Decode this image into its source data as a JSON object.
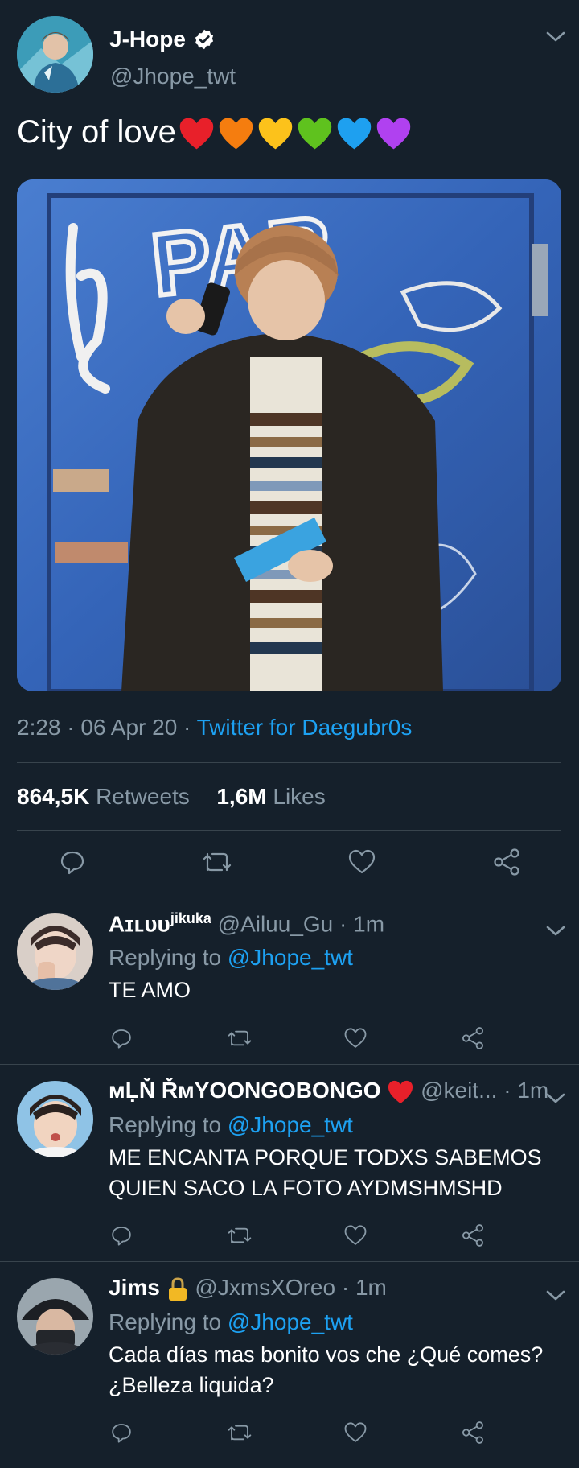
{
  "tweet": {
    "author_name": "J-Hope",
    "handle": "@Jhope_twt",
    "text": "City of love",
    "emoji": [
      "red-heart",
      "orange-heart",
      "yellow-heart",
      "green-heart",
      "blue-heart",
      "purple-heart"
    ],
    "heart_colors": [
      "#e8202a",
      "#f57d0f",
      "#fcc21b",
      "#5fc21e",
      "#1ea0f0",
      "#b041f0"
    ],
    "photo": "person in dark coat in front of graffitied blue door holding blue envelope",
    "time": "2:28",
    "date": "06 Apr 20",
    "source": "Twitter for Daegubr0s",
    "retweets_count": "864,5K",
    "retweets_label": "Retweets",
    "likes_count": "1,6M",
    "likes_label": "Likes",
    "photo_graffiti": "PAR"
  },
  "actions": [
    "reply-icon",
    "retweet-icon",
    "like-icon",
    "share-icon"
  ],
  "replies": [
    {
      "name": "Aɪʟᴜᴜ",
      "name_sup": "jikuka",
      "handle": "@Ailuu_Gu",
      "time": "1m",
      "replying_prefix": "Replying to",
      "mention": "@Jhope_twt",
      "text": "TE AMO"
    },
    {
      "name": "ᴍḶŇ ŘᴍYOONGOBONGO",
      "name_emoji": "red-heart",
      "handle": "@keit...",
      "time": "1m",
      "replying_prefix": "Replying to",
      "mention": "@Jhope_twt",
      "text": "ME ENCANTA PORQUE TODXS SABEMOS QUIEN SACO LA FOTO AYDMSHMSHD"
    },
    {
      "name": "Jims",
      "name_emoji": "lock-icon",
      "handle": "@JxmsXOreo",
      "time": "1m",
      "replying_prefix": "Replying to",
      "mention": "@Jhope_twt",
      "text": "Cada días mas bonito vos che ¿Qué comes? ¿Belleza liquida?"
    }
  ],
  "colors": {
    "background": "#15202b",
    "text_secondary": "#8899a6",
    "accent": "#1da1f2",
    "divider": "#38444d"
  }
}
